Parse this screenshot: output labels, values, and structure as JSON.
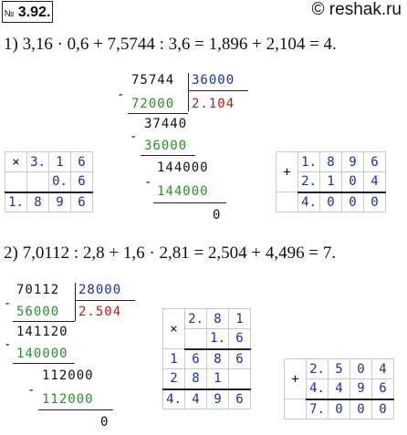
{
  "header": {
    "number_prefix": "№",
    "number": "3.92.",
    "site": "© reshak.ru"
  },
  "task1": {
    "equation": "1) 3,16 · 0,6 + 7,5744 : 3,6 = 1,896 + 2,104 = 4.",
    "division": {
      "dividend": "75744",
      "divisor": "36000",
      "quotient": "2.104",
      "rows": [
        "72000",
        "37440",
        "36000",
        "144000",
        "144000",
        "0"
      ]
    },
    "mult": {
      "sign": "×",
      "a": [
        "3.",
        "1",
        "6"
      ],
      "b": [
        "0.",
        "6"
      ],
      "result": [
        "1.",
        "8",
        "9",
        "6"
      ]
    },
    "add": {
      "sign": "+",
      "a": [
        "1.",
        "8",
        "9",
        "6"
      ],
      "b": [
        "2.",
        "1",
        "0",
        "4"
      ],
      "result": [
        "4.",
        "0",
        "0",
        "0"
      ]
    }
  },
  "task2": {
    "equation": "2) 7,0112 : 2,8 + 1,6 · 2,81 = 2,504 + 4,496 = 7.",
    "division": {
      "dividend": "70112",
      "divisor": "28000",
      "quotient": "2.504",
      "rows": [
        "56000",
        "141120",
        "140000",
        "112000",
        "112000",
        "0"
      ]
    },
    "mult": {
      "sign": "×",
      "a": [
        "2.",
        "8",
        "1"
      ],
      "b": [
        "1.",
        "6"
      ],
      "p1": [
        "1",
        "6",
        "8",
        "6"
      ],
      "p2": [
        "2",
        "8",
        "1"
      ],
      "result": [
        "4.",
        "4",
        "9",
        "6"
      ]
    },
    "add": {
      "sign": "+",
      "a": [
        "2.",
        "5",
        "0",
        "4"
      ],
      "b": [
        "4.",
        "4",
        "9",
        "6"
      ],
      "result": [
        "7.",
        "0",
        "0",
        "0"
      ]
    }
  },
  "minus": "-"
}
